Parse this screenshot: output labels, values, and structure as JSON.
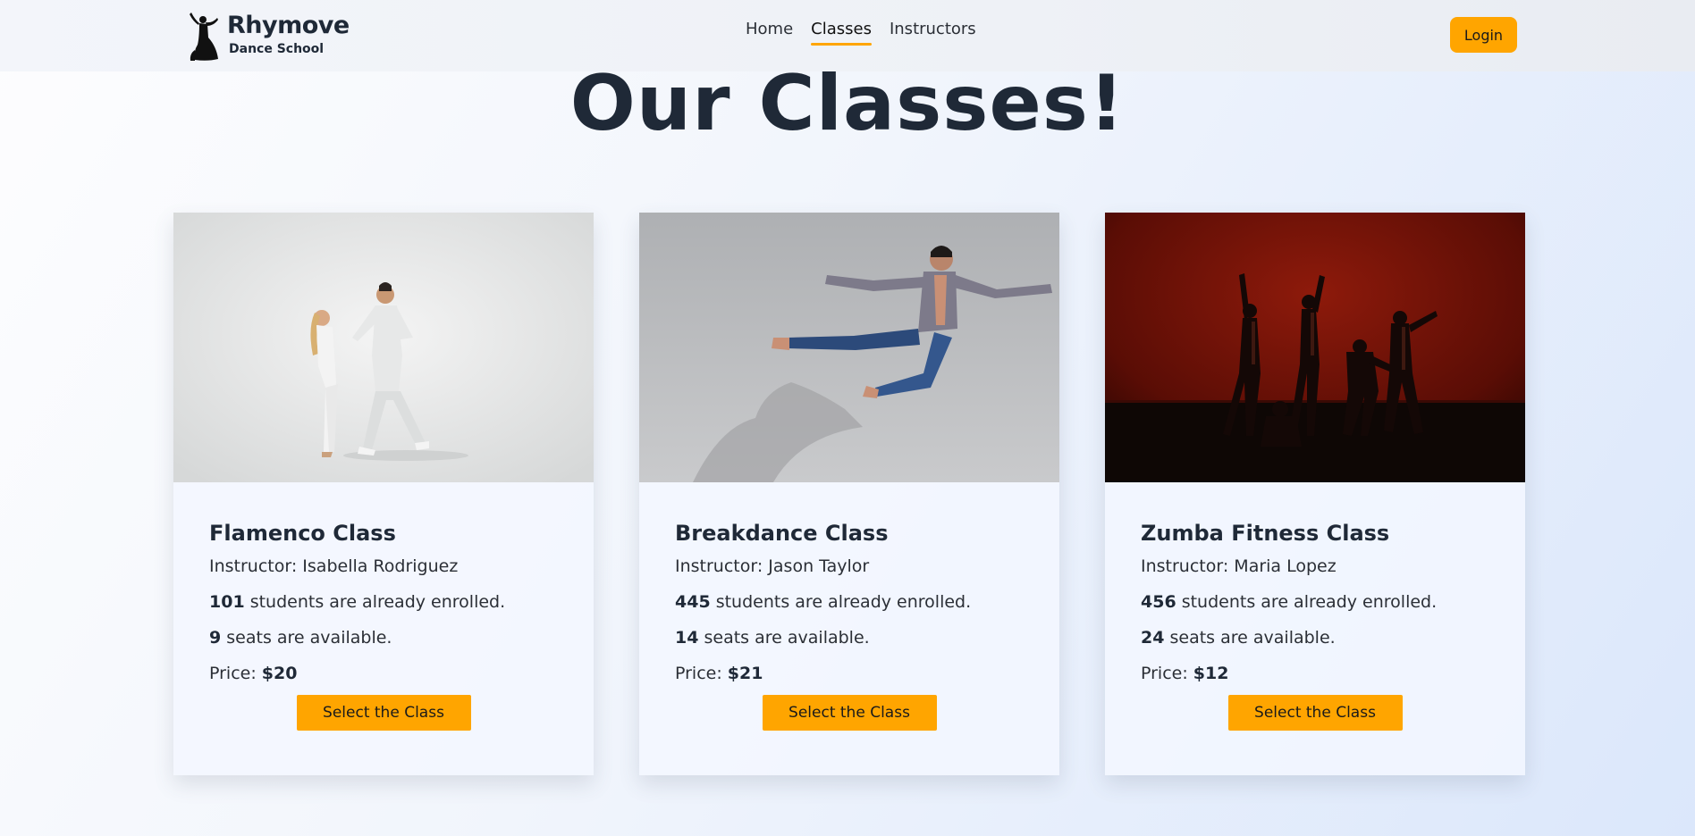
{
  "header": {
    "brand_name": "Rhymove",
    "brand_sub": "Dance School",
    "nav": [
      {
        "label": "Home",
        "active": false
      },
      {
        "label": "Classes",
        "active": true
      },
      {
        "label": "Instructors",
        "active": false
      }
    ],
    "login_label": "Login",
    "accent_color": "#ffa500"
  },
  "main": {
    "title": "Our Classes!",
    "classes": [
      {
        "name": "Flamenco Class",
        "instructor_prefix": "Instructor: ",
        "instructor": "Isabella Rodriguez",
        "enrolled": "101",
        "enrolled_suffix": " students are already enrolled.",
        "seats": "9",
        "seats_suffix": " seats are available.",
        "price_prefix": "Price: ",
        "price": "$20",
        "button_label": "Select the Class",
        "image": "dancing-couple-photo"
      },
      {
        "name": "Breakdance Class",
        "instructor_prefix": "Instructor: ",
        "instructor": "Jason Taylor",
        "enrolled": "445",
        "enrolled_suffix": " students are already enrolled.",
        "seats": "14",
        "seats_suffix": " seats are available.",
        "price_prefix": "Price: ",
        "price": "$21",
        "button_label": "Select the Class",
        "image": "jumping-dancer-photo"
      },
      {
        "name": "Zumba Fitness Class",
        "instructor_prefix": "Instructor: ",
        "instructor": "Maria Lopez",
        "enrolled": "456",
        "enrolled_suffix": " students are already enrolled.",
        "seats": "24",
        "seats_suffix": " seats are available.",
        "price_prefix": "Price: ",
        "price": "$12",
        "button_label": "Select the Class",
        "image": "stage-group-dance-photo"
      }
    ]
  }
}
